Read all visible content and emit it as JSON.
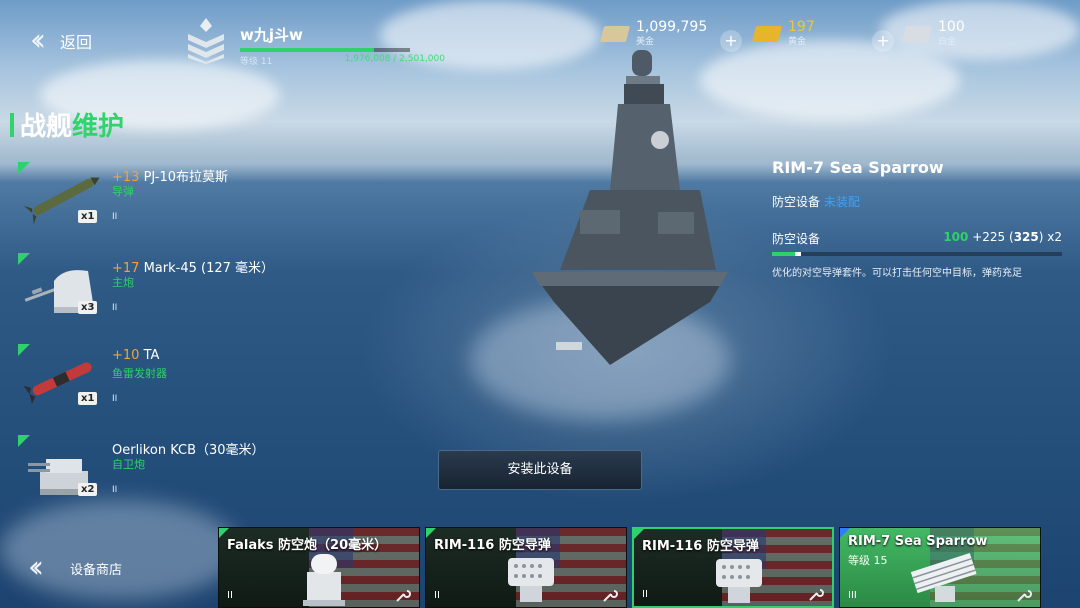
{
  "header": {
    "back_label": "返回",
    "player": {
      "name": "w九j斗w",
      "level_label": "等级 11",
      "xp_text": "1,976,008 / 2,501,000",
      "xp_fraction": 0.79
    },
    "currencies": [
      {
        "value": "1,099,795",
        "label": "美金",
        "color": "#d8c79a"
      },
      {
        "value": "197",
        "label": "黄金",
        "color": "#e6b52c"
      },
      {
        "value": "100",
        "label": "白金",
        "color": "#d7dde3"
      }
    ]
  },
  "page_title": {
    "part1": "战舰",
    "part2": "维护"
  },
  "equipment": [
    {
      "bonus": "+13",
      "name": "PJ-10布拉莫斯",
      "type": "导弹",
      "qty": "x1",
      "tier": "II",
      "icon": "missile-icon"
    },
    {
      "bonus": "+17",
      "name": "Mark-45 (127 毫米）",
      "type": "主炮",
      "qty": "x3",
      "tier": "II",
      "icon": "naval-gun-icon"
    },
    {
      "bonus": "+10",
      "name": "TA",
      "type": "鱼雷发射器",
      "qty": "x1",
      "tier": "II",
      "icon": "torpedo-icon"
    },
    {
      "bonus": "",
      "name": "Oerlikon KCB（30毫米）",
      "type": "自卫炮",
      "qty": "x2",
      "tier": "II",
      "icon": "autocannon-icon"
    }
  ],
  "detail": {
    "title": "RIM-7 Sea Sparrow",
    "category": "防空设备",
    "category_link": "未装配",
    "stat_label": "防空设备",
    "stat_base": "100",
    "stat_add": "+225",
    "stat_total": "325",
    "stat_mult": "x2",
    "description": "优化的对空导弹套件。可以打击任何空中目标，弹药充足"
  },
  "install_label": "安装此设备",
  "shop_label": "设备商店",
  "cards": [
    {
      "name": "Falaks 防空炮（20毫米）",
      "level": "",
      "tier": "II",
      "icon": "ciws-turret-icon"
    },
    {
      "name": "RIM-116 防空导弹",
      "level": "",
      "tier": "II",
      "icon": "missile-launcher-icon"
    },
    {
      "name": "RIM-116 防空导弹",
      "level": "",
      "tier": "II",
      "icon": "missile-launcher-icon"
    },
    {
      "name": "RIM-7 Sea Sparrow",
      "level": "等级 15",
      "tier": "III",
      "icon": "sam-launcher-icon"
    }
  ],
  "colors": {
    "accent_green": "#2fd16a",
    "bonus_orange": "#f2a23a",
    "link_blue": "#3aa2ff"
  }
}
